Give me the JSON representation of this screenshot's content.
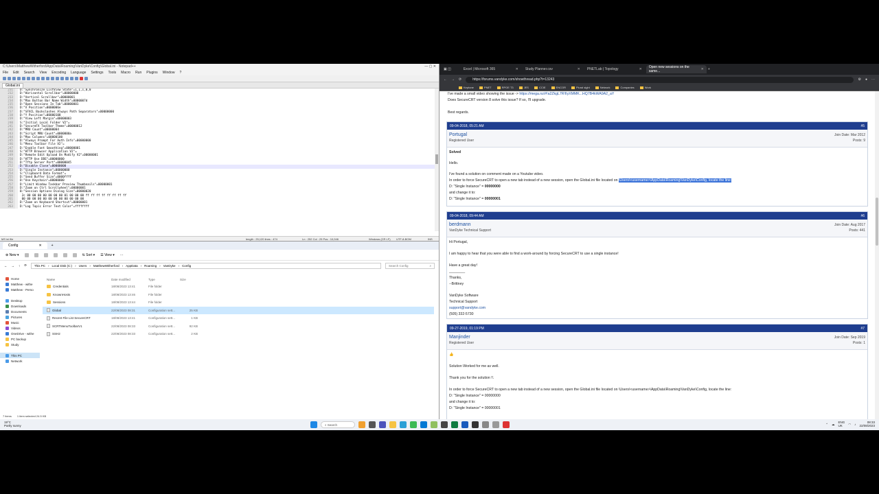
{
  "notepad": {
    "title": "C:\\Users\\MatthewWitherford\\AppData\\Roaming\\VanDyke\\Config\\Global.ini - Notepad++",
    "menu": [
      "File",
      "Edit",
      "Search",
      "View",
      "Encoding",
      "Language",
      "Settings",
      "Tools",
      "Macro",
      "Run",
      "Plugins",
      "Window",
      "?"
    ],
    "tab": "Global.ini",
    "lines": [
      {
        "n": "231",
        "t": "D:\"Synchronize ListView State\"=1,1,1,0,0"
      },
      {
        "n": "232",
        "t": "D:\"Horizontal Scrollbar\"=00000000"
      },
      {
        "n": "233",
        "t": "D:\"Vertical Scrollbar\"=00000001"
      },
      {
        "n": "234",
        "t": "D:\"Max Button Bar Name Width\"=0000007d"
      },
      {
        "n": "235",
        "t": "D:\"Open Sessions In Tab\"=00000001"
      },
      {
        "n": "236",
        "t": "D:\"X Position\"=0000006e"
      },
      {
        "n": "237",
        "t": "D:\"SFXCL Backslashes Always Path Separators\"=00000000"
      },
      {
        "n": "238",
        "t": "D:\"Y Position\"=00000108"
      },
      {
        "n": "239",
        "t": "D:\"View Left Margin\"=00000003"
      },
      {
        "n": "240",
        "t": "S:\"Initial Local Folder V2\"="
      },
      {
        "n": "241",
        "t": "D:\"SecureFX Toolbar Theme\"=00000012"
      },
      {
        "n": "242",
        "t": "D:\"MRU Count\"=00000004"
      },
      {
        "n": "243",
        "t": "D:\"Script MRU Count\"=0000000a"
      },
      {
        "n": "244",
        "t": "D:\"Max Columns\"=00000100"
      },
      {
        "n": "245",
        "t": "D:\"Always Prompt For Auth Info\"=00000000"
      },
      {
        "n": "246",
        "t": "S:\"Menu Toolbar File V2\"="
      },
      {
        "n": "247",
        "t": "D:\"Enable Font Smoothing\"=00000001"
      },
      {
        "n": "248",
        "t": "S:\"HTTP Browser Application V2\"="
      },
      {
        "n": "249",
        "t": "D:\"Remote Edit Upload On Modify V2\"=00000001"
      },
      {
        "n": "250",
        "t": "D:\"HTTP Use DDE\"=00000000"
      },
      {
        "n": "251",
        "t": "D:\"Tftp Server Port\"=00000045"
      },
      {
        "n": "252",
        "t": "D:\"Disable Close\"=00000000"
      },
      {
        "n": "253",
        "t": "D:\"Single Instance\"=00000000"
      },
      {
        "n": "254",
        "t": "S:\"Clipboard Data Format\"="
      },
      {
        "n": "255",
        "t": "D:\"Send Buffer Size\"=0000ffff"
      },
      {
        "n": "256",
        "t": "D:\"Use Keychain\"=00000000"
      },
      {
        "n": "257",
        "t": "D:\"Limit Window Taskbar Preview Thumbnails\"=00000001"
      },
      {
        "n": "258",
        "t": "D:\"Zoom on Ctrl Scrollwheel\"=00000001"
      },
      {
        "n": "259",
        "t": "B:\"Session Options Dialog Size\"=00000020"
      },
      {
        "n": "260",
        "t": " 2c 00 00 00 00 00 00 00 01 00 00 00 ff ff ff ff ff ff ff ff"
      },
      {
        "n": "261",
        "t": " 00 00 00 00 00 00 00 00 00 00 00 00"
      },
      {
        "n": "262",
        "t": "D:\"Zoom on Keyboard Shortcut\"=00000001"
      },
      {
        "n": "263",
        "t": "D:\"Log Topic Error Text Color\"=ffffffff"
      }
    ],
    "status": {
      "type": "MS ini file",
      "length": "length : 25,120    lines : 474",
      "pos": "Ln : 252    Col : 29    Pos : 10,046",
      "eol": "Windows (CR LF)",
      "enc": "UTF-8-BOM",
      "mode": "INS"
    }
  },
  "explorer": {
    "tab": "Config",
    "commands": [
      "New",
      "Sort",
      "View"
    ],
    "path": [
      "This PC",
      "Local Disk (C:)",
      "Users",
      "MatthewWitherford",
      "AppData",
      "Roaming",
      "VanDyke",
      "Config"
    ],
    "search_placeholder": "Search Config",
    "nav": [
      {
        "label": "Home",
        "color": "#e2543c"
      },
      {
        "label": "Matthew - withe",
        "color": "#3a7bd5"
      },
      {
        "label": "Matthew - Perso",
        "color": "#3a7bd5"
      },
      {
        "label": "",
        "color": "transparent"
      },
      {
        "label": "Desktop",
        "color": "#4a9be8"
      },
      {
        "label": "Downloads",
        "color": "#3a8f4a"
      },
      {
        "label": "Documents",
        "color": "#5c7fb0"
      },
      {
        "label": "Pictures",
        "color": "#4aa3df"
      },
      {
        "label": "Music",
        "color": "#e2543c"
      },
      {
        "label": "Videos",
        "color": "#8a4bd5"
      },
      {
        "label": "OneDrive - withe",
        "color": "#3a7bd5"
      },
      {
        "label": "PC backup",
        "color": "#f6c343"
      },
      {
        "label": "Study",
        "color": "#f6c343"
      },
      {
        "label": "",
        "color": "transparent"
      },
      {
        "label": "This PC",
        "color": "#4a9be8"
      },
      {
        "label": "Network",
        "color": "#4a9be8"
      }
    ],
    "columns": [
      "Name",
      "Date modified",
      "Type",
      "Size"
    ],
    "rows": [
      {
        "name": "Credentials",
        "date": "18/08/2023 13:41",
        "type": "File folder",
        "size": "",
        "folder": true
      },
      {
        "name": "KnownHosts",
        "date": "18/08/2023 13:46",
        "type": "File folder",
        "size": "",
        "folder": true
      },
      {
        "name": "Sessions",
        "date": "18/08/2023 13:44",
        "type": "File folder",
        "size": "",
        "folder": true
      },
      {
        "name": "Global",
        "date": "22/08/2023 08:31",
        "type": "Configuration sett...",
        "size": "25 KB",
        "folder": false
      },
      {
        "name": "Recent File List SecureCRT",
        "date": "18/08/2023 13:41",
        "type": "Configuration sett...",
        "size": "1 KB",
        "folder": false
      },
      {
        "name": "SCRTMenuToolbarV1",
        "date": "22/08/2023 08:33",
        "type": "Configuration sett...",
        "size": "92 KB",
        "folder": false
      },
      {
        "name": "SSH2",
        "date": "22/08/2023 08:33",
        "type": "Configuration sett...",
        "size": "2 KB",
        "folder": false
      }
    ],
    "status_items": "7 items",
    "status_selected": "1 item selected  24.5 KB"
  },
  "browser": {
    "tabs": [
      "Excel | Microsoft 365",
      "Study Planner.csv",
      "PNETLab | Topology",
      "Open new sessions on the same..."
    ],
    "url": "https://forums.vandyke.com/showthread.php?t=13243",
    "bookmarks": [
      "Keptone",
      "PNET",
      "RPOE T3",
      "JES",
      "CCIE",
      "ENCOR",
      "Plural sight",
      "Network",
      "Companies",
      "Work"
    ],
    "top_text": {
      "line1a": "I've made a small video showing the issue ->",
      "line1b": "https://mega.nz/#!a2ZkgL7R!lIyXMMK...HQ7B4kWA9A2_aY",
      "line2": "Does SecureCRT version 8 solve this issue? If so, I'll upgrade.",
      "line3": "Best regards."
    },
    "posts": [
      {
        "date": "09-04-2018, 05:21 AM",
        "num": "#5",
        "user": "Portugal",
        "role": "Registered User",
        "join": "Join Date: Mar 2012",
        "count": "Posts: 9",
        "lines": {
          "b1": "Solved",
          "b2": "Hello.",
          "b3": "I've found a solution on comment made on a Youtube video.",
          "b4a": "In order to force SecureCRT to open a new tab instead of a new session, open the Global.ini file located on",
          "b4b": "\\Users\\<username>\\AppData\\Roaming\\VanDyke\\Config, locate the line:",
          "b5a": "D: \"Single Instance\" =",
          "b5b": "00000000",
          "b6": "and change it to:",
          "b7a": "D: \"Single Instance\" =",
          "b7b": "00000001"
        }
      },
      {
        "date": "09-04-2018, 09:44 AM",
        "num": "#6",
        "user": "berdmann",
        "role": "VanDyke Technical Support",
        "join": "Join Date: Aug 2017",
        "count": "Posts: 441",
        "lines": {
          "b1": "Hi Portugal,",
          "b2": "I am happy to hear that you were able to find a work-around by forcing SecureCRT to use a single instance!",
          "b3": "Have a great day!",
          "b4": "________",
          "b5": "Thanks,",
          "b6": "--Brittney",
          "b7": "VanDyke Software",
          "b8": "Technical Support",
          "b9": "support@vandyke.com",
          "b10": "(505) 332-5730"
        }
      },
      {
        "date": "09-27-2019, 01:19 PM",
        "num": "#7",
        "user": "Manjinder",
        "role": "Registered User",
        "join": "Join Date: Sep 2019",
        "count": "Posts: 1",
        "lines": {
          "b1": "👍",
          "b2": "Solution Worked for me as well.",
          "b3": "Thank you for the solution !!.",
          "b4": "In order to force SecureCRT to open a new tab instead of a new session, open the Global.ini file located on \\Users\\<username>\\AppData\\Roaming\\VanDyke\\Config, locate the line:",
          "b5": "D: \"Single Instance\" = 00000000",
          "b6": "and change it to:",
          "b7": "D: \"Single Instance\" = 00000001"
        }
      }
    ]
  },
  "taskbar": {
    "temp": "19°C",
    "weather": "Partly sunny",
    "search": "Search",
    "lang": "ENG",
    "region": "UK",
    "time": "08:33",
    "date": "22/08/2023"
  }
}
